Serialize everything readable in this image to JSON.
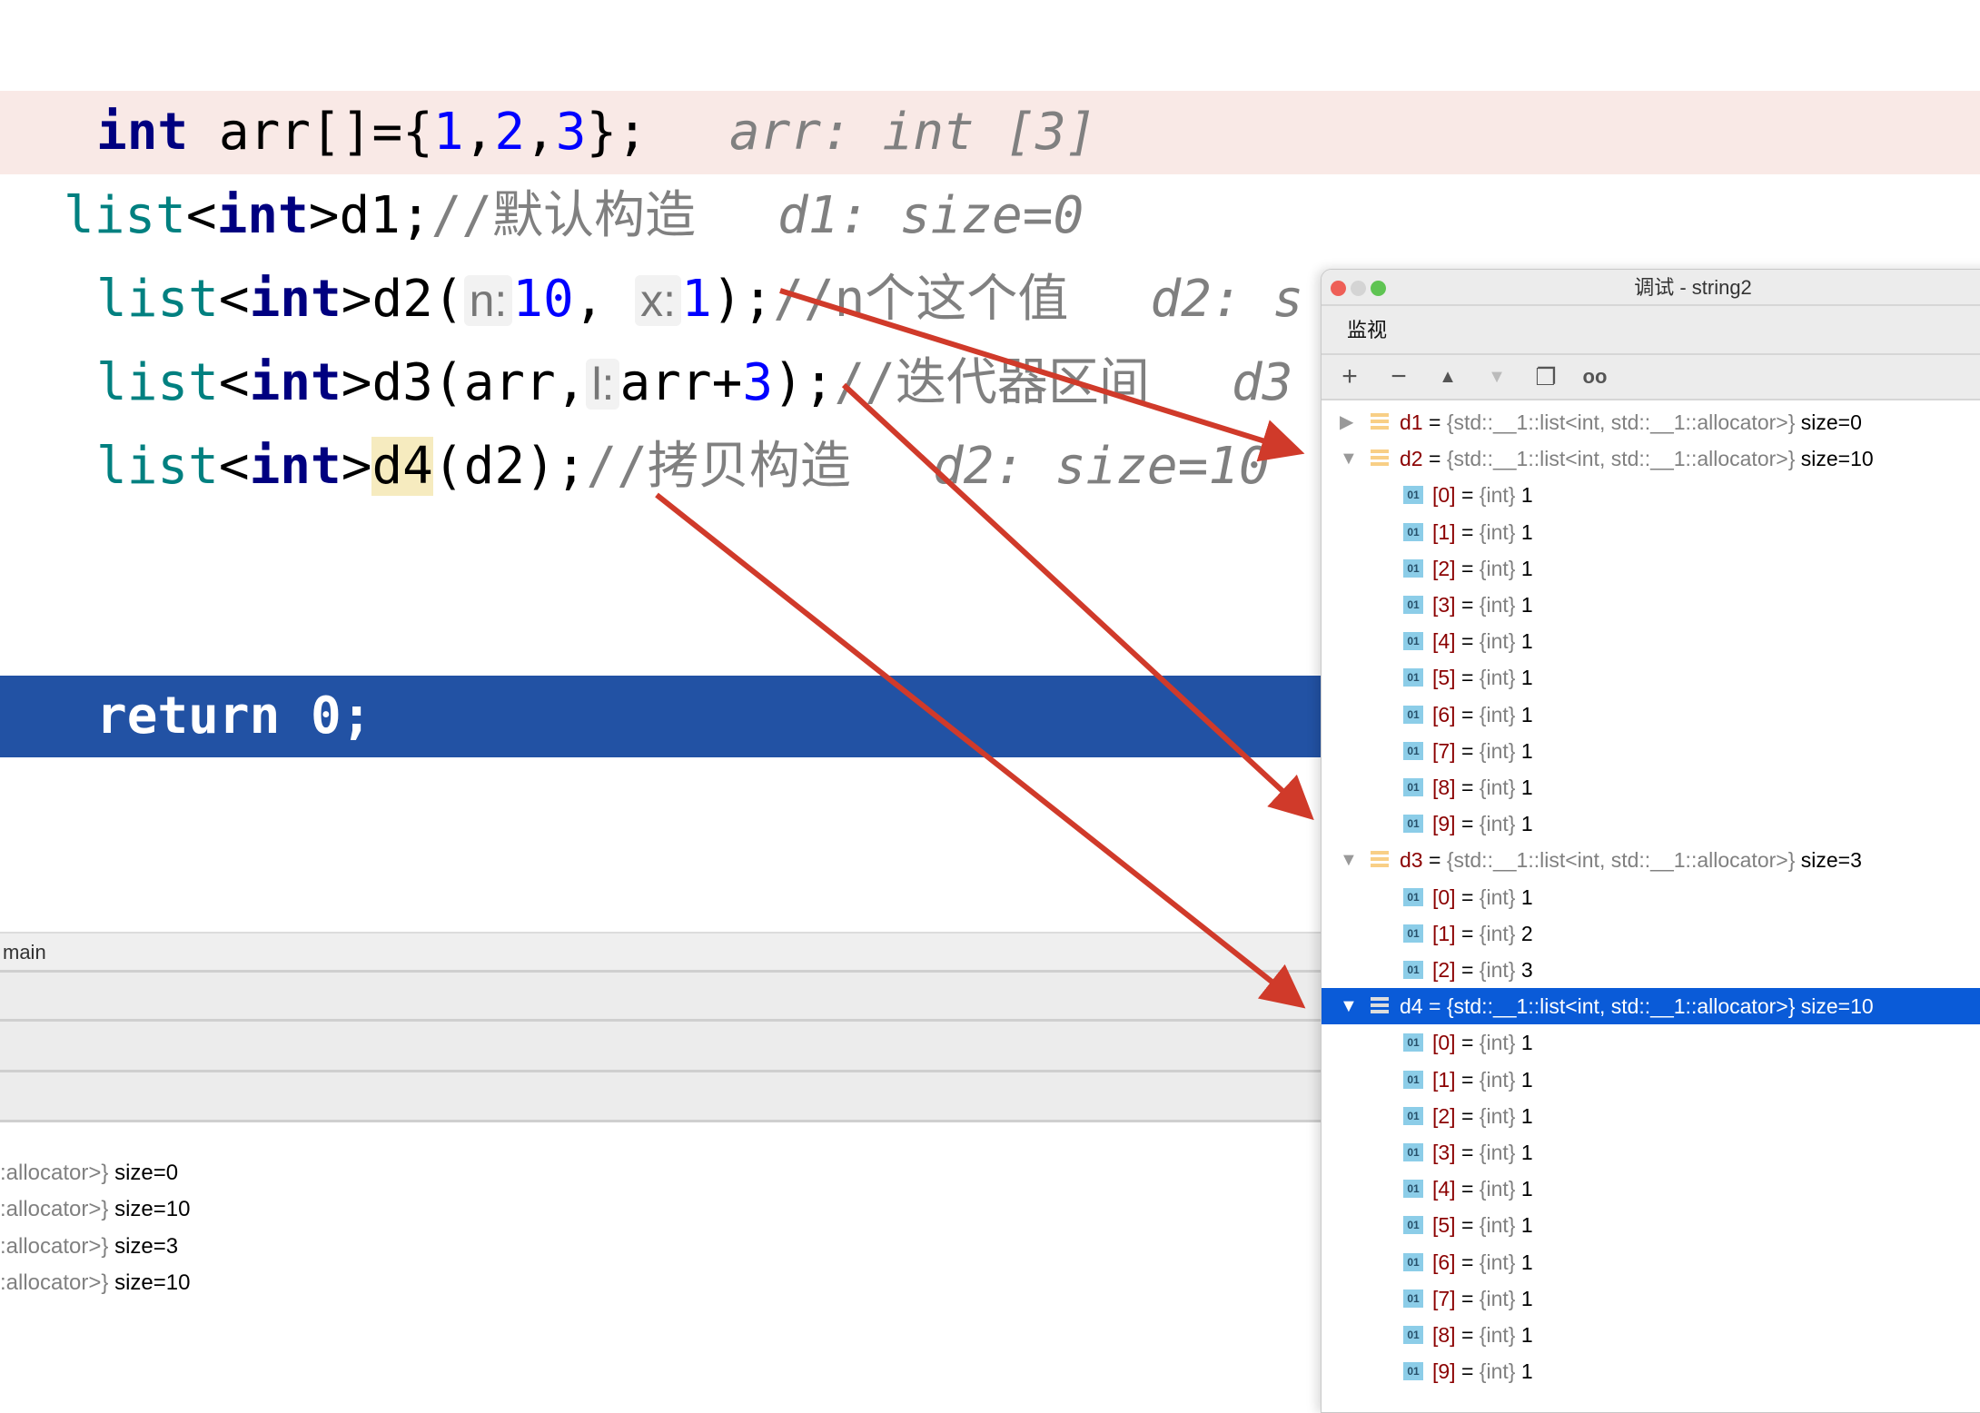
{
  "editor": {
    "line1": {
      "kw": "int",
      "rest": " arr[]={",
      "n1": "1",
      "c1": ",",
      "n2": "2",
      "c2": ",",
      "n3": "3",
      "end": "};",
      "hint": "arr: int [3]"
    },
    "line2": {
      "ty": "list",
      "lt": "<",
      "kw": "int",
      "rest": ">d1;",
      "comment": "//默认构造",
      "hint": "d1: size=0"
    },
    "line3": {
      "ty": "list",
      "lt": "<",
      "kw": "int",
      "rest": ">d2(",
      "p1": "n:",
      "v1": "10",
      "sep": ",",
      "p2": "x:",
      "v2": "1",
      "end": ");",
      "comment": "//n个这个值",
      "hint": "d2: s"
    },
    "line4": {
      "ty": "list",
      "lt": "<",
      "kw": "int",
      "rest": ">d3(arr,",
      "p1": "l:",
      "a": "arr+",
      "v": "3",
      "end": ");",
      "comment": "//迭代器区间",
      "hint": "d3"
    },
    "line5": {
      "ty": "list",
      "lt": "<",
      "kw": "int",
      "rest": ">",
      "hl": "d4",
      "end": "(d2);",
      "comment": "//拷贝构造",
      "hint": "d2: size=10"
    },
    "return_line": "return 0;"
  },
  "frames": {
    "current": "main"
  },
  "variables_partial": [
    {
      "type": ":allocator>}",
      "value": "size=0"
    },
    {
      "type": ":allocator>}",
      "value": "size=10"
    },
    {
      "type": ":allocator>}",
      "value": "size=3"
    },
    {
      "type": ":allocator>}",
      "value": "size=10"
    }
  ],
  "debug_window": {
    "title": "调试 - string2",
    "section": "监视",
    "toolbar": [
      "plus-icon",
      "minus-icon",
      "arrow-up-icon",
      "arrow-down-icon",
      "copy-icon",
      "glasses-icon"
    ],
    "colors": {
      "selection": "#0a5bd8",
      "arrow": "#d03a2a"
    },
    "tree": [
      {
        "name": "d1",
        "type": "{std::__1::list<int, std::__1::allocator>}",
        "value": "size=0",
        "expanded": false,
        "children": []
      },
      {
        "name": "d2",
        "type": "{std::__1::list<int, std::__1::allocator>}",
        "value": "size=10",
        "expanded": true,
        "children": [
          "1",
          "1",
          "1",
          "1",
          "1",
          "1",
          "1",
          "1",
          "1",
          "1"
        ]
      },
      {
        "name": "d3",
        "type": "{std::__1::list<int, std::__1::allocator>}",
        "value": "size=3",
        "expanded": true,
        "children": [
          "1",
          "2",
          "3"
        ]
      },
      {
        "name": "d4",
        "type": "{std::__1::list<int, std::__1::allocator>}",
        "value": "size=10",
        "expanded": true,
        "selected": true,
        "children": [
          "1",
          "1",
          "1",
          "1",
          "1",
          "1",
          "1",
          "1",
          "1",
          "1"
        ]
      }
    ],
    "child_type": "{int}"
  }
}
